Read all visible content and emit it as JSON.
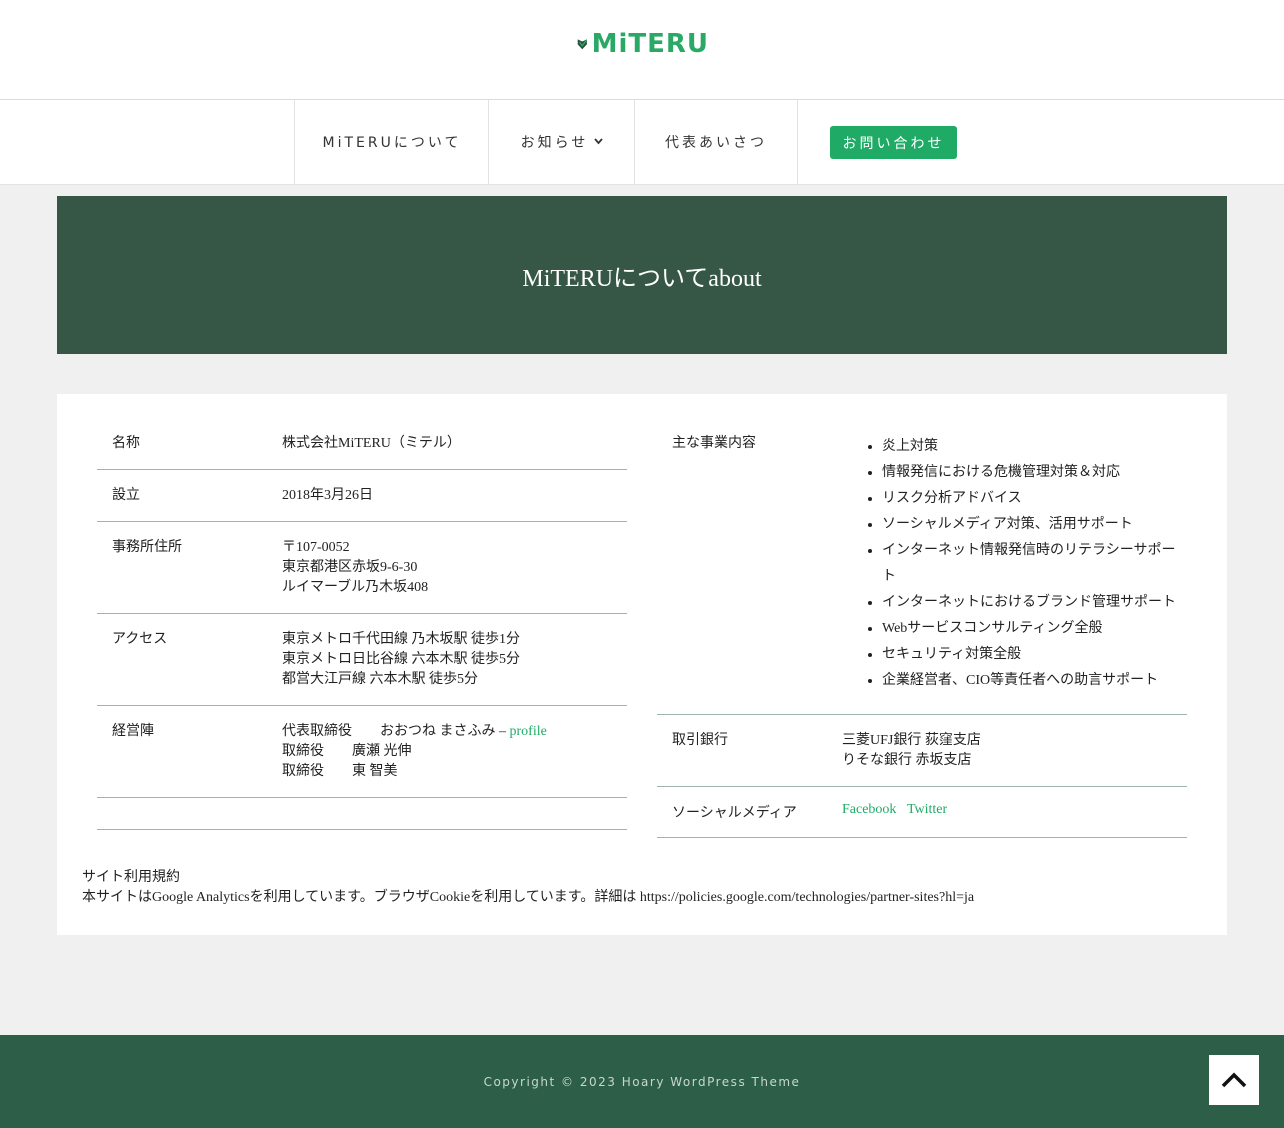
{
  "header": {
    "logo_text": "MiTERU",
    "brand_color": "#2aa866"
  },
  "nav": {
    "items": [
      {
        "label": "MiTERUについて"
      },
      {
        "label": "お知らせ",
        "has_dropdown": true
      },
      {
        "label": "代表あいさつ"
      }
    ],
    "contact_label": "お問い合わせ"
  },
  "hero": {
    "title": "MiTERUについてabout",
    "bg_color": "#375746"
  },
  "company": {
    "left_rows": [
      {
        "key": "名称",
        "lines": [
          "株式会社MiTERU（ミテル）"
        ]
      },
      {
        "key": "設立",
        "lines": [
          "2018年3月26日"
        ]
      },
      {
        "key": "事務所住所",
        "lines": [
          "〒107-0052",
          "東京都港区赤坂9-6-30",
          "ルイマーブル乃木坂408"
        ]
      },
      {
        "key": "アクセス",
        "lines": [
          "東京メトロ千代田線 乃木坂駅 徒歩1分",
          "東京メトロ日比谷線 六本木駅 徒歩5分",
          "都営大江戸線 六本木駅 徒歩5分"
        ]
      },
      {
        "key": "経営陣",
        "lines": [
          "代表取締役　　おおつね まさふみ – ",
          "取締役　　廣瀬 光伸",
          "取締役　　東 智美"
        ],
        "profile_link": "profile"
      }
    ],
    "business": {
      "key": "主な事業内容",
      "items": [
        "炎上対策",
        "情報発信における危機管理対策＆対応",
        "リスク分析アドバイス",
        "ソーシャルメディア対策、活用サポート",
        "インターネット情報発信時のリテラシーサポート",
        "インターネットにおけるブランド管理サポート",
        "Webサービスコンサルティング全般",
        "セキュリティ対策全般",
        "企業経営者、CIO等責任者への助言サポート"
      ]
    },
    "bank": {
      "key": "取引銀行",
      "lines": [
        "三菱UFJ銀行 荻窪支店",
        "りそな銀行 赤坂支店"
      ]
    },
    "social": {
      "key": "ソーシャルメディア",
      "links": [
        "Facebook",
        "Twitter"
      ]
    }
  },
  "notes": {
    "terms": "サイト利用規約",
    "analytics": "本サイトはGoogle Analyticsを利用しています。ブラウザCookieを利用しています。詳細は https://policies.google.com/technologies/partner-sites?hl=ja"
  },
  "footer": {
    "copyright": "Copyright © 2023 Hoary WordPress Theme",
    "bg_color": "#2c5e48"
  },
  "icons": {
    "logo": "shield-check-icon",
    "dropdown": "chevron-down-icon",
    "scroll_top": "chevron-up-icon"
  }
}
